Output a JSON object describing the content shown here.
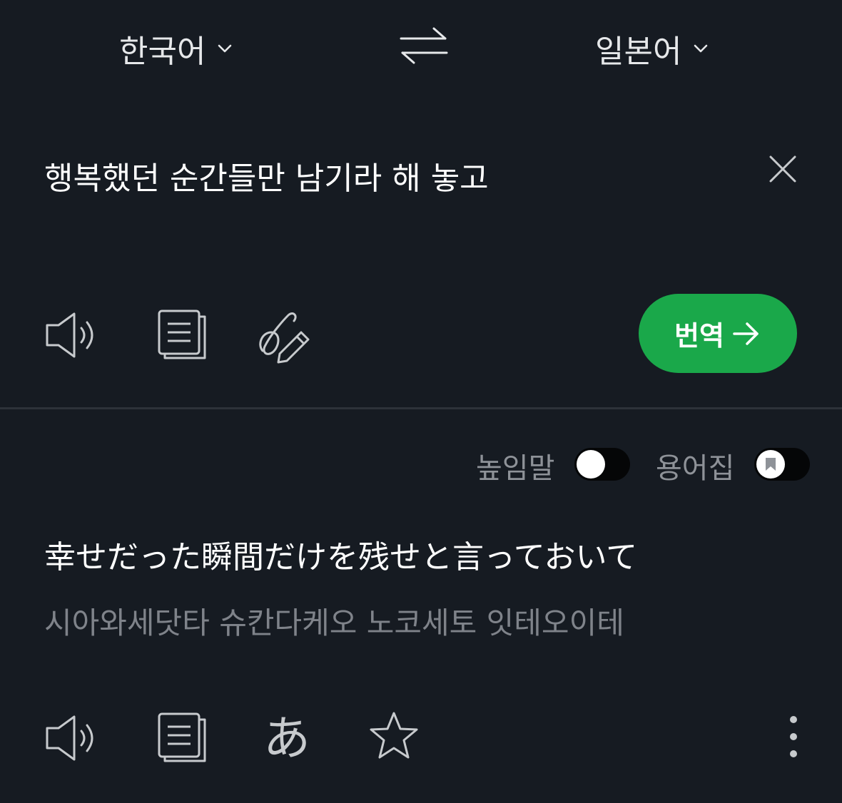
{
  "languages": {
    "source_label": "한국어",
    "target_label": "일본어"
  },
  "source": {
    "text": "행복했던 순간들만 남기라 해 놓고"
  },
  "actions": {
    "translate_label": "번역"
  },
  "options": {
    "honorific_label": "높임말",
    "honorific_enabled": false,
    "glossary_label": "용어집",
    "glossary_enabled": false
  },
  "result": {
    "text": "幸せだった瞬間だけを残せと言っておいて",
    "pronunciation": "시아와세닷타 슈칸다케오 노코세토 잇테오이테",
    "kana_icon_glyph": "あ"
  },
  "colors": {
    "background": "#161b22",
    "accent": "#1aa84a",
    "icon": "#c7cacd",
    "muted_text": "#7f838a"
  },
  "icons": {
    "source_toolbar": [
      "speaker-icon",
      "copy-icon",
      "handwriting-icon"
    ],
    "result_toolbar": [
      "speaker-icon",
      "copy-icon",
      "kana-icon",
      "star-icon",
      "more-vertical-icon"
    ]
  }
}
